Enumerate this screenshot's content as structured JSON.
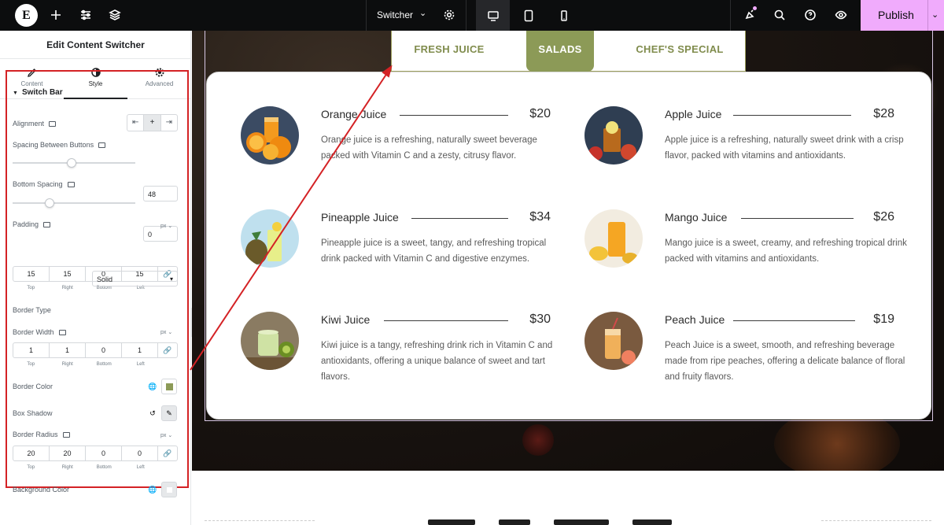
{
  "topbar": {
    "logo": "E",
    "doc_title": "Switcher",
    "publish": "Publish",
    "icons": [
      "add-icon",
      "settings-sliders-icon",
      "layers-icon",
      "gear-icon",
      "desktop-icon",
      "tablet-icon",
      "mobile-icon",
      "notifications-icon",
      "search-icon",
      "help-icon",
      "preview-eye-icon"
    ]
  },
  "panel": {
    "title": "Edit Content Switcher",
    "tabs": [
      {
        "label": "Content"
      },
      {
        "label": "Style"
      },
      {
        "label": "Advanced"
      }
    ],
    "section": "Switch Bar",
    "alignment_label": "Alignment",
    "spacing_label": "Spacing Between Buttons",
    "spacing_value": "48",
    "spacing_fraction": 0.48,
    "bottom_label": "Bottom Spacing",
    "bottom_value": "0",
    "bottom_fraction": 0.3,
    "padding_label": "Padding",
    "padding_unit": "px",
    "padding": {
      "top": "15",
      "right": "15",
      "bottom": "0",
      "left": "15"
    },
    "dim_labels": {
      "top": "Top",
      "right": "Right",
      "bottom": "Bottom",
      "left": "Left"
    },
    "border_type_label": "Border Type",
    "border_type_value": "Solid",
    "border_width_label": "Border Width",
    "border_width_unit": "px",
    "border_width": {
      "top": "1",
      "right": "1",
      "bottom": "0",
      "left": "1"
    },
    "border_color_label": "Border Color",
    "border_color": "#8c9a57",
    "box_shadow_label": "Box Shadow",
    "border_radius_label": "Border Radius",
    "border_radius_unit": "px",
    "border_radius": {
      "top": "20",
      "right": "20",
      "bottom": "0",
      "left": "0"
    },
    "background_color_label": "Background Color",
    "background_color": "#ffffff"
  },
  "switcher": {
    "tabs": [
      "FRESH JUICE",
      "SALADS",
      "CHEF'S SPECIAL"
    ],
    "active_tab": "SALADS",
    "accent": "#8c9a57"
  },
  "menu": [
    {
      "name": "Orange Juice",
      "price": "$20",
      "desc": "Orange juice is a refreshing, naturally sweet beverage packed with Vitamin C and a zesty, citrusy flavor."
    },
    {
      "name": "Apple Juice",
      "price": "$28",
      "desc": "Apple juice is a refreshing, naturally sweet drink with a crisp flavor, packed with vitamins and antioxidants."
    },
    {
      "name": "Pineapple Juice",
      "price": "$34",
      "desc": "Pineapple juice is a sweet, tangy, and refreshing tropical drink packed with Vitamin C and digestive enzymes."
    },
    {
      "name": "Mango Juice",
      "price": "$26",
      "desc": "Mango juice is a sweet, creamy, and refreshing tropical drink packed with vitamins and antioxidants."
    },
    {
      "name": "Kiwi Juice",
      "price": "$30",
      "desc": "Kiwi juice is a tangy, refreshing drink rich in Vitamin C and antioxidants, offering a unique balance of sweet and tart flavors."
    },
    {
      "name": "Peach Juice",
      "price": "$19",
      "desc": "Peach Juice is a sweet, smooth, and refreshing beverage made from ripe peaches, offering a delicate balance of floral and fruity flavors."
    }
  ]
}
